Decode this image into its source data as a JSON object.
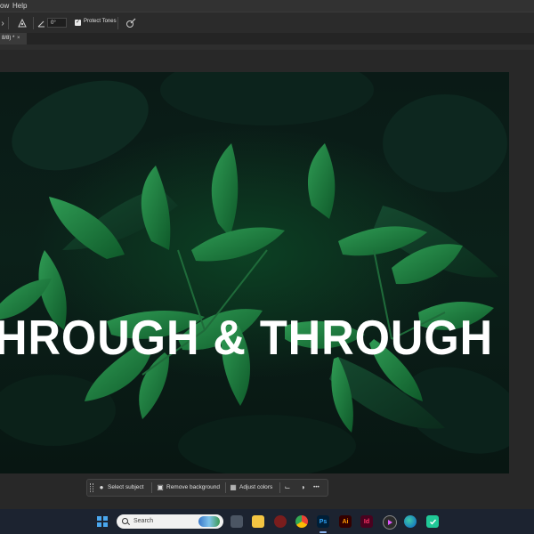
{
  "menubar": {
    "items": [
      "ow",
      "Help"
    ]
  },
  "options_bar": {
    "angle_value": "0°",
    "protect_tones_label": "Protect Tones",
    "protect_tones_checked": "✓"
  },
  "document_tab": {
    "label": "8/8) *",
    "close": "×"
  },
  "canvas": {
    "headline": "HROUGH & THROUGH"
  },
  "contextual_taskbar": {
    "select_subject": "Select subject",
    "remove_background": "Remove background",
    "adjust_colors": "Adjust colors",
    "more": "•••"
  },
  "taskbar": {
    "search_placeholder": "Search",
    "apps": [
      "File Explorer",
      "Chrome",
      "Photoshop",
      "Illustrator",
      "InDesign",
      "Media Player",
      "Edge",
      "Security"
    ],
    "ps_label": "Ps",
    "ai_label": "Ai",
    "id_label": "Id"
  },
  "colors": {
    "accent_blue": "#4aa7ee",
    "photoshop": "#31a8ff",
    "illustrator": "#ff9a00",
    "indesign": "#ff3366"
  }
}
